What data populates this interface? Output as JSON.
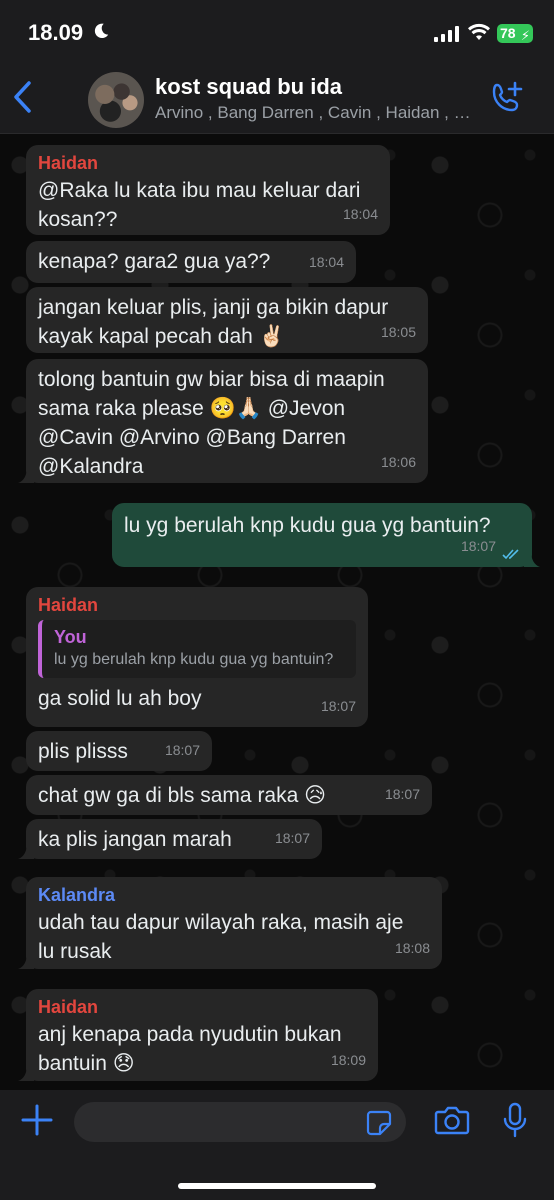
{
  "status_bar": {
    "time": "18.09",
    "battery": "78"
  },
  "header": {
    "title": "kost squad bu ida",
    "members": "Arvino , Bang Darren , Cavin , Haidan , Jevon , Kalandra"
  },
  "messages": [
    {
      "sender": "Haidan",
      "text": "@Raka lu kata ibu mau keluar dari\nkosan??",
      "time": "18:04"
    },
    {
      "text": "kenapa? gara2 gua ya??",
      "time": "18:04"
    },
    {
      "text": "jangan keluar plis, janji ga bikin dapur\nkayak kapal pecah dah ✌🏻",
      "time": "18:05"
    },
    {
      "text": "tolong bantuin gw biar bisa di maapin\nsama raka please 🥺🙏🏻  @Jevon\n@Cavin @Arvino @Bang Darren\n@Kalandra",
      "time": "18:06"
    },
    {
      "text": "lu yg berulah knp kudu gua yg bantuin?",
      "time": "18:07",
      "outgoing": true
    },
    {
      "sender": "Haidan",
      "quote_author": "You",
      "quote_text": "lu yg berulah knp kudu gua yg bantuin?",
      "text": "ga solid lu ah boy",
      "time": "18:07"
    },
    {
      "text": "plis plisss",
      "time": "18:07"
    },
    {
      "text": "chat gw ga di bls sama raka 😥",
      "time": "18:07"
    },
    {
      "text": "ka plis jangan marah",
      "time": "18:07"
    },
    {
      "sender": "Kalandra",
      "text": "udah tau dapur wilayah raka, masih aje\nlu rusak",
      "time": "18:08"
    },
    {
      "sender": "Haidan",
      "text": "anj kenapa pada nyudutin bukan\nbantuin 😞",
      "time": "18:09"
    }
  ],
  "composer": {
    "placeholder": ""
  },
  "colors": {
    "incoming": "#262626",
    "outgoing": "#1f4a3a",
    "accent": "#3b82f6",
    "haidan": "#e2463e",
    "kalandra": "#5c8af5",
    "you": "#c064d8"
  },
  "icons": [
    "back-icon",
    "add-call-icon",
    "plus-icon",
    "sticker-icon",
    "camera-icon",
    "mic-icon",
    "read-ticks-icon"
  ]
}
